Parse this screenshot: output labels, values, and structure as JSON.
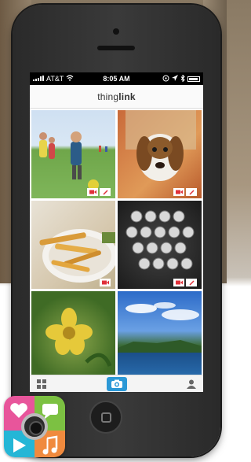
{
  "statusbar": {
    "carrier": "AT&T",
    "time": "8:05 AM"
  },
  "appbar": {
    "logo_prefix": "thing",
    "logo_suffix": "link"
  },
  "grid": {
    "items": [
      {
        "name": "kids-playing-photo",
        "tags": [
          "video",
          "edit"
        ]
      },
      {
        "name": "dog-photo",
        "tags": [
          "video",
          "edit"
        ]
      },
      {
        "name": "fries-photo",
        "tags": [
          "video"
        ]
      },
      {
        "name": "typewriter-photo",
        "tags": [
          "video",
          "edit"
        ]
      },
      {
        "name": "flower-photo",
        "tags": []
      },
      {
        "name": "lake-photo",
        "tags": []
      }
    ]
  },
  "tabbar": {
    "left_icon": "grid-icon",
    "center_icon": "camera-icon",
    "right_icon": "profile-icon"
  },
  "colors": {
    "accent": "#2b98d6",
    "tag_red": "#e0303a"
  }
}
